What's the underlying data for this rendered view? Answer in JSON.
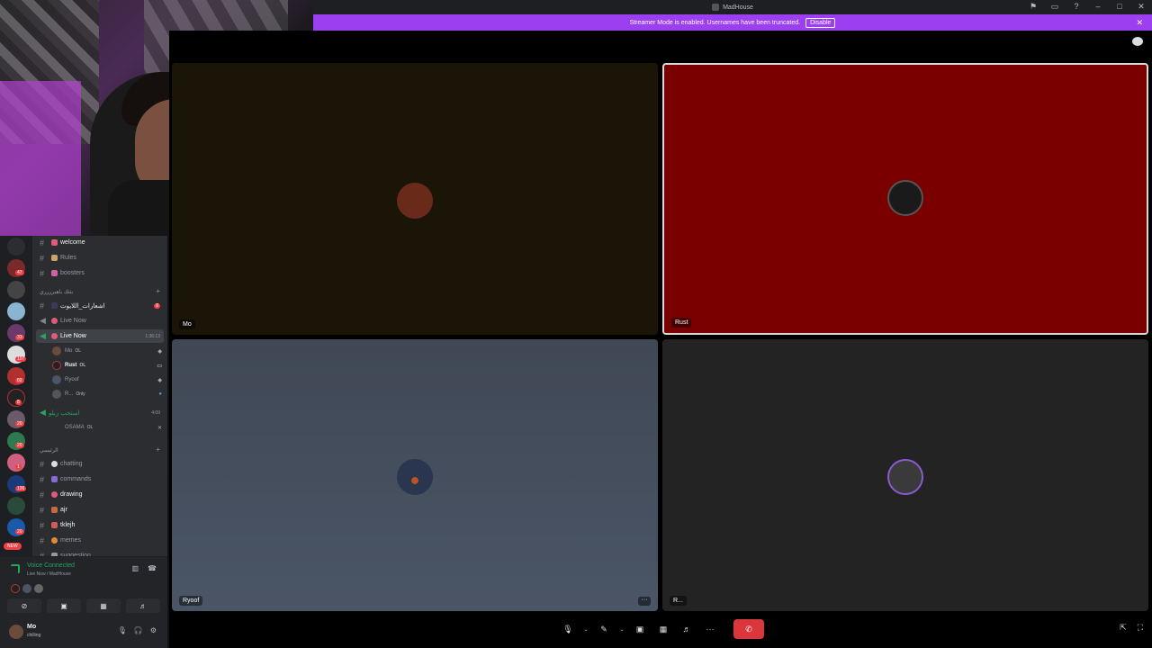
{
  "window": {
    "title": "MadHouse",
    "controls": [
      "⚑",
      "▭",
      "?",
      "–",
      "□",
      "✕"
    ]
  },
  "banner": {
    "text": "Streamer Mode is enabled. Usernames have been truncated.",
    "disable_label": "Disable",
    "close": "✕"
  },
  "server_rail": {
    "badges": [
      "47",
      "33",
      "107",
      "82",
      "8",
      "20",
      "20",
      "1",
      "136",
      "20"
    ],
    "new_label": "NEW"
  },
  "channels": {
    "welcome": "welcome",
    "rules": "Rules",
    "boosters": "boosters",
    "category1": "بثثك باهيرررري",
    "ch_arabic": "اشعارات_اللايوت",
    "live_now_1": "Live Now",
    "live_now_2": "Live Now",
    "live_now_2_time": "1:36:13",
    "voice_users": [
      {
        "name": "Mo",
        "tag": "OL"
      },
      {
        "name": "Rust",
        "tag": "OL"
      },
      {
        "name": "Ryoof",
        "tag": ""
      },
      {
        "name": "R...",
        "tag": "Only"
      }
    ],
    "voice2": "استحب زيلو",
    "voice2_time": "4:09",
    "voice2_user": "OSAMA",
    "voice2_user_tag": "OL",
    "category2": "الرئيسي",
    "chatting": "chatting",
    "commands": "commands",
    "drawing": "drawing",
    "ajr": "ajr",
    "tklejh": "tklejh",
    "memes": "memes",
    "suggestion": "suggestion"
  },
  "voice_panel": {
    "title": "Voice Connected",
    "subtitle": "Live Now / MadHouse"
  },
  "user_panel": {
    "name": "Mo",
    "status": "chilling"
  },
  "tiles": {
    "mo": "Mo",
    "rust": "Rust",
    "ryoof": "Ryoof",
    "r": "R...",
    "more": "···"
  },
  "controls": {
    "mic": "🎙",
    "camera": "✎",
    "screen": "▣",
    "activity": "▦",
    "soundboard": "♬",
    "more": "···",
    "hangup": "✆",
    "popout": "⇱",
    "fullscreen": "⛶"
  }
}
